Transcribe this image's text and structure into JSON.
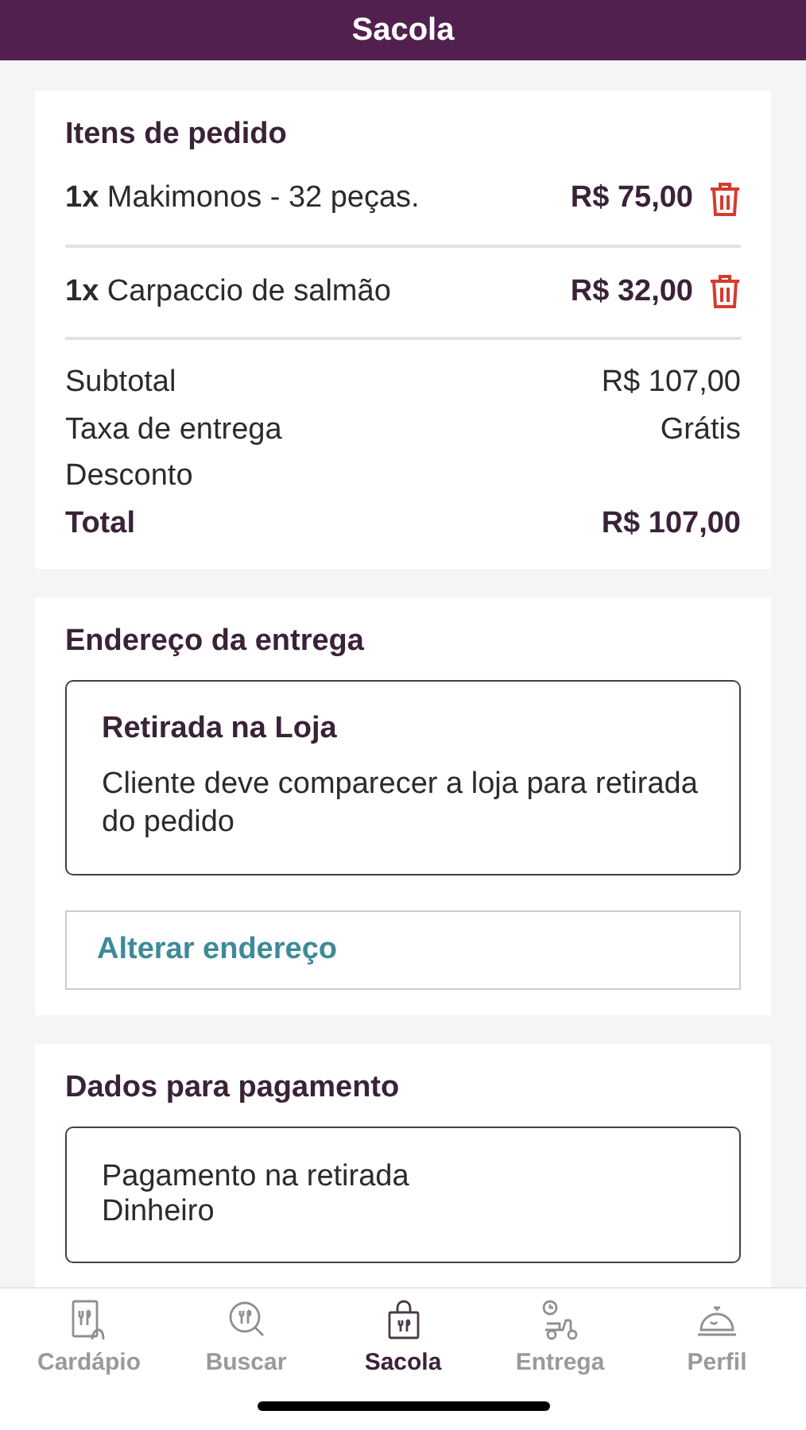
{
  "header": {
    "title": "Sacola"
  },
  "order": {
    "title": "Itens de pedido",
    "items": [
      {
        "name": "**1x** Makimonos - 32 peças.",
        "price": "R$ 75,00"
      },
      {
        "name": "**1x** Carpaccio de salmão",
        "price": "R$ 32,00"
      }
    ],
    "summary": [
      {
        "label": "Subtotal",
        "value": "R$ 107,00",
        "kind": "normal"
      },
      {
        "label": "Taxa de entrega",
        "value": "Grátis",
        "kind": "normal"
      },
      {
        "label": "Desconto",
        "kind": "normal"
      },
      {
        "label": "Total",
        "value": "R$ 107,00",
        "kind": "total"
      }
    ]
  },
  "address": {
    "title": "Endereço da entrega",
    "option_title": "Retirada na Loja",
    "option_text": "Cliente deve comparecer a loja para retirada do pedido",
    "button": "Alterar endereço"
  },
  "payment": {
    "title": "Dados para pagamento",
    "lines": [
      "Pagamento na retirada",
      "Dinheiro"
    ]
  },
  "tabs": [
    {
      "label": "Cardápio",
      "selected": false
    },
    {
      "label": "Buscar",
      "selected": false
    },
    {
      "label": "Sacola",
      "selected": true
    },
    {
      "label": "Entrega",
      "selected": false
    },
    {
      "label": "Perfil",
      "selected": false
    }
  ]
}
